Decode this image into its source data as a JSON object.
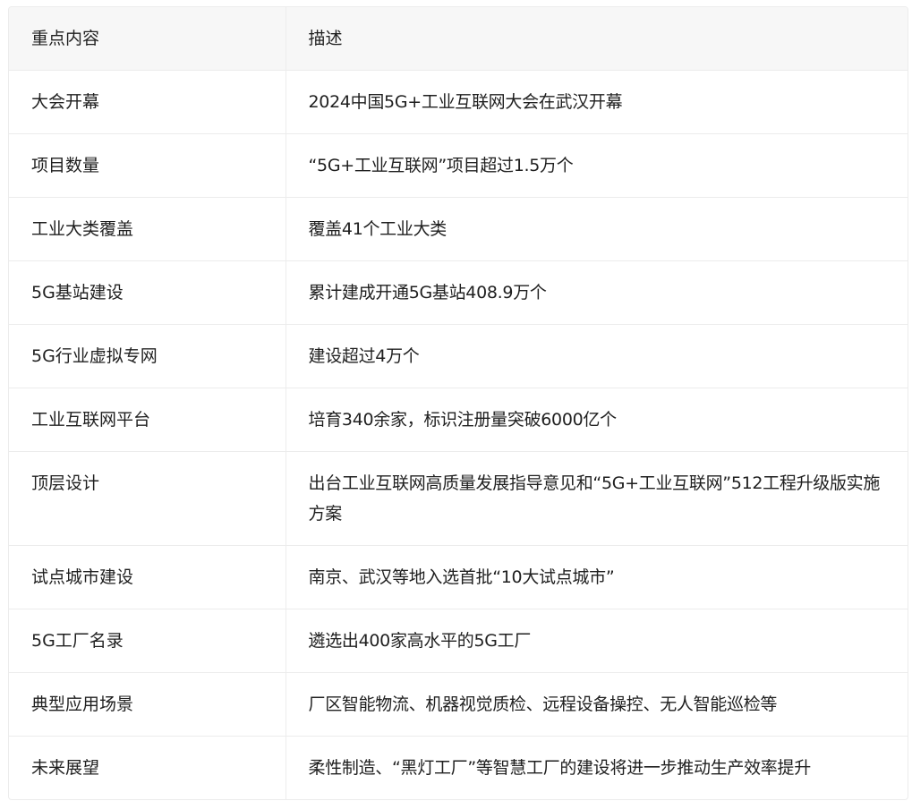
{
  "table": {
    "headers": [
      "重点内容",
      "描述"
    ],
    "rows": [
      {
        "key": "大会开幕",
        "desc": "2024中国5G+工业互联网大会在武汉开幕"
      },
      {
        "key": "项目数量",
        "desc": "“5G+工业互联网”项目超过1.5万个"
      },
      {
        "key": "工业大类覆盖",
        "desc": "覆盖41个工业大类"
      },
      {
        "key": "5G基站建设",
        "desc": "累计建成开通5G基站408.9万个"
      },
      {
        "key": "5G行业虚拟专网",
        "desc": "建设超过4万个"
      },
      {
        "key": "工业互联网平台",
        "desc": "培育340余家，标识注册量突破6000亿个"
      },
      {
        "key": "顶层设计",
        "desc": "出台工业互联网高质量发展指导意见和“5G+工业互联网”512工程升级版实施方案"
      },
      {
        "key": "试点城市建设",
        "desc": "南京、武汉等地入选首批“10大试点城市”"
      },
      {
        "key": "5G工厂名录",
        "desc": "遴选出400家高水平的5G工厂"
      },
      {
        "key": "典型应用场景",
        "desc": "厂区智能物流、机器视觉质检、远程设备操控、无人智能巡检等"
      },
      {
        "key": "未来展望",
        "desc": "柔性制造、“黑灯工厂”等智慧工厂的建设将进一步推动生产效率提升"
      }
    ]
  }
}
